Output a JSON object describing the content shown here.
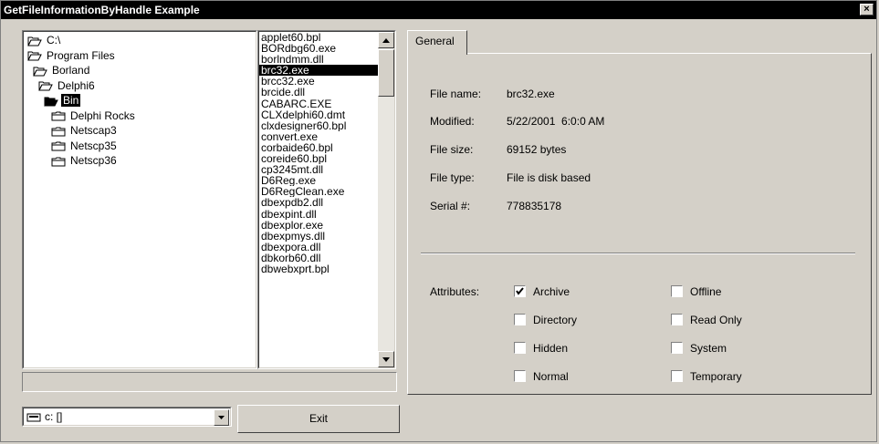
{
  "window": {
    "title": "GetFileInformationByHandle Example",
    "close_glyph": "×"
  },
  "tree": {
    "items": [
      {
        "label": "C:\\",
        "icon": "open-folder-icon",
        "selected": false
      },
      {
        "label": "Program Files",
        "icon": "open-folder-icon",
        "selected": false
      },
      {
        "label": "Borland",
        "icon": "open-folder-icon",
        "selected": false
      },
      {
        "label": "Delphi6",
        "icon": "open-folder-icon",
        "selected": false
      },
      {
        "label": "Bin",
        "icon": "open-folder-icon",
        "selected": true
      },
      {
        "label": "Delphi Rocks",
        "icon": "folder-icon",
        "selected": false
      },
      {
        "label": "Netscap3",
        "icon": "folder-icon",
        "selected": false
      },
      {
        "label": "Netscp35",
        "icon": "folder-icon",
        "selected": false
      },
      {
        "label": "Netscp36",
        "icon": "folder-icon",
        "selected": false
      }
    ]
  },
  "files": {
    "selected": "brc32.exe",
    "items": [
      "applet60.bpl",
      "BORdbg60.exe",
      "borlndmm.dll",
      "brc32.exe",
      "brcc32.exe",
      "brcide.dll",
      "CABARC.EXE",
      "CLXdelphi60.dmt",
      "clxdesigner60.bpl",
      "convert.exe",
      "corbaide60.bpl",
      "coreide60.bpl",
      "cp3245mt.dll",
      "D6Reg.exe",
      "D6RegClean.exe",
      "dbexpdb2.dll",
      "dbexpint.dll",
      "dbexplor.exe",
      "dbexpmys.dll",
      "dbexpora.dll",
      "dbkorb60.dll",
      "dbwebxprt.bpl"
    ],
    "scroll_up_icon": "triangle-up-icon",
    "scroll_down_icon": "triangle-down-icon"
  },
  "status": {
    "text": ""
  },
  "drive": {
    "label": "c: []",
    "icon": "drive-icon"
  },
  "buttons": {
    "exit": "Exit"
  },
  "tabs": [
    {
      "label": "General"
    }
  ],
  "info": {
    "file_name_label": "File name:",
    "file_name": "brc32.exe",
    "modified_label": "Modified:",
    "modified": "5/22/2001  6:0:0 AM",
    "file_size_label": "File size:",
    "file_size": "69152 bytes",
    "file_type_label": "File type:",
    "file_type": "File is disk based",
    "serial_label": "Serial #:",
    "serial": "778835178"
  },
  "attributes": {
    "label": "Attributes:",
    "items": [
      {
        "label": "Archive",
        "checked": true
      },
      {
        "label": "Directory",
        "checked": false
      },
      {
        "label": "Hidden",
        "checked": false
      },
      {
        "label": "Normal",
        "checked": false
      },
      {
        "label": "Offline",
        "checked": false
      },
      {
        "label": "Read Only",
        "checked": false
      },
      {
        "label": "System",
        "checked": false
      },
      {
        "label": "Temporary",
        "checked": false
      }
    ]
  }
}
